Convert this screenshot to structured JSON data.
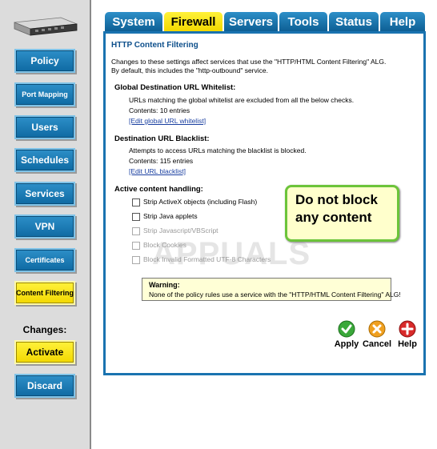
{
  "sidebar": {
    "device_image": "router-device",
    "items": [
      {
        "label": "Policy"
      },
      {
        "label": "Port Mapping"
      },
      {
        "label": "Users"
      },
      {
        "label": "Schedules"
      },
      {
        "label": "Services"
      },
      {
        "label": "VPN"
      },
      {
        "label": "Certificates"
      },
      {
        "label": "Content Filtering"
      }
    ],
    "changes_label": "Changes:",
    "activate_label": "Activate",
    "discard_label": "Discard"
  },
  "tabs": [
    {
      "label": "System"
    },
    {
      "label": "Firewall"
    },
    {
      "label": "Servers"
    },
    {
      "label": "Tools"
    },
    {
      "label": "Status"
    },
    {
      "label": "Help"
    }
  ],
  "panel": {
    "title": "HTTP Content Filtering",
    "intro_line1": "Changes to these settings affect services that use the \"HTTP/HTML Content Filtering\" ALG.",
    "intro_line2": "By default, this includes the \"http-outbound\" service.",
    "whitelist": {
      "heading": "Global Destination URL Whitelist:",
      "description": "URLs matching the global whitelist are excluded from all the below checks.",
      "contents": "Contents: 10 entries",
      "link": "[Edit global URL whitelist]"
    },
    "blacklist": {
      "heading": "Destination URL Blacklist:",
      "description": "Attempts to access URLs matching the blacklist is blocked.",
      "contents": "Contents: 115 entries",
      "link": "[Edit URL blacklist]"
    },
    "active_content": {
      "heading": "Active content handling:",
      "options": [
        {
          "label": "Strip ActiveX objects (including Flash)",
          "checked": false,
          "enabled": true
        },
        {
          "label": "Strip Java applets",
          "checked": false,
          "enabled": true
        },
        {
          "label": "Strip Javascript/VBScript",
          "checked": false,
          "enabled": false
        },
        {
          "label": "Block Cookies",
          "checked": false,
          "enabled": false
        },
        {
          "label": "Block Invalid Formatted UTF-8 Characters",
          "checked": false,
          "enabled": false
        }
      ]
    },
    "warning": {
      "title": "Warning:",
      "text": "None of the policy rules use a service with the \"HTTP/HTML Content Filtering\" ALG!"
    },
    "actions": {
      "apply": "Apply",
      "cancel": "Cancel",
      "help": "Help"
    }
  },
  "callout": {
    "line1": "Do not block",
    "line2": "any content"
  },
  "watermark": "APPUALS",
  "colors": {
    "tab_blue": "#1a73b0",
    "active_yellow": "#fff23a",
    "callout_border": "#6cc43a",
    "callout_bg": "#ffffcc"
  }
}
